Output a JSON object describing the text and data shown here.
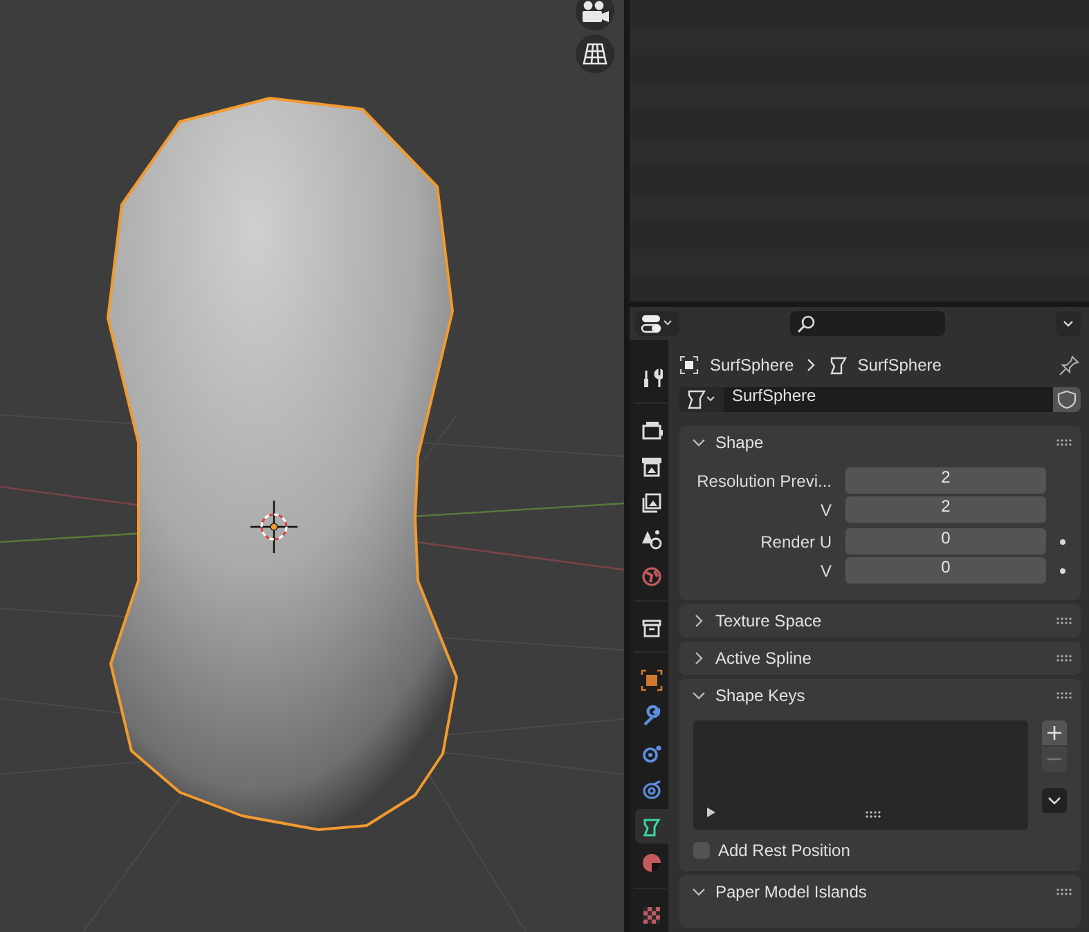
{
  "properties": {
    "tabs": [
      {
        "kind": "tool",
        "selected": false
      },
      {
        "kind": "render",
        "selected": false
      },
      {
        "kind": "output",
        "selected": false
      },
      {
        "kind": "view_layer",
        "selected": false
      },
      {
        "kind": "scene",
        "selected": false
      },
      {
        "kind": "world",
        "selected": false
      },
      {
        "kind": "collection",
        "selected": false
      },
      {
        "kind": "object",
        "selected": false
      },
      {
        "kind": "modifiers",
        "selected": false
      },
      {
        "kind": "particles",
        "selected": false
      },
      {
        "kind": "physics",
        "selected": false
      },
      {
        "kind": "data",
        "selected": true
      },
      {
        "kind": "material",
        "selected": false
      },
      {
        "kind": "texture",
        "selected": false
      }
    ],
    "breadcrumb": [
      "SurfSphere",
      "SurfSphere"
    ],
    "datablock": {
      "value": "SurfSphere"
    },
    "panels": [
      {
        "title": "Shape",
        "expanded": true,
        "kind": "fields",
        "fields": [
          {
            "label": "Resolution Previ...",
            "value": "2",
            "keyframe_dot": false
          },
          {
            "label": "V",
            "value": "2",
            "keyframe_dot": false
          },
          {
            "label": "Render U",
            "value": "0",
            "keyframe_dot": true
          },
          {
            "label": "V",
            "value": "0",
            "keyframe_dot": true
          }
        ]
      },
      {
        "title": "Texture Space",
        "expanded": false
      },
      {
        "title": "Active Spline",
        "expanded": false
      },
      {
        "title": "Shape Keys",
        "expanded": true,
        "kind": "shape_keys",
        "add_rest_position": {
          "label": "Add Rest Position",
          "checked": false
        }
      },
      {
        "title": "Paper Model Islands",
        "expanded": true
      }
    ]
  }
}
